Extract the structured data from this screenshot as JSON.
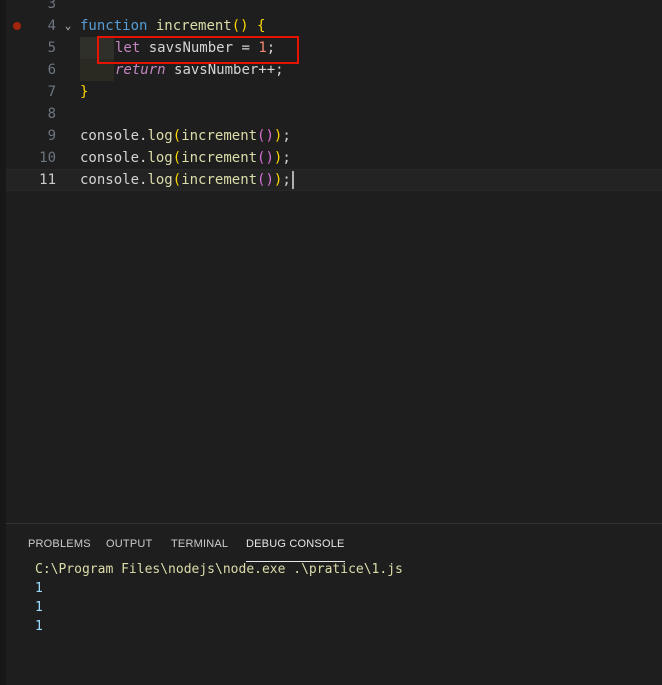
{
  "editor": {
    "line_numbers": [
      "3",
      "4",
      "5",
      "6",
      "7",
      "8",
      "9",
      "10",
      "11"
    ],
    "lines": {
      "l4": {
        "kw": "function",
        "name": "increment",
        "open_paren": "(",
        "close_paren": ")",
        "brace": " {"
      },
      "l5": {
        "kw": "let",
        "var": "savsNumber",
        "op": " = ",
        "num": "1",
        "semi": ";"
      },
      "l6": {
        "kw": "return",
        "var": "savsNumber",
        "op": "++;"
      },
      "l7": {
        "brace": "}"
      },
      "l9": {
        "obj": "console",
        "dot": ".",
        "method": "log",
        "p1": "(",
        "fn": "increment",
        "p2": "()",
        "p3": ")",
        "semi": ";"
      },
      "l10": {
        "obj": "console",
        "dot": ".",
        "method": "log",
        "p1": "(",
        "fn": "increment",
        "p2": "()",
        "p3": ")",
        "semi": ";"
      },
      "l11": {
        "obj": "console",
        "dot": ".",
        "method": "log",
        "p1": "(",
        "fn": "increment",
        "p2": "()",
        "p3": ")",
        "semi": ";"
      }
    },
    "breakpoint_line": "4",
    "active_line": "11"
  },
  "panel": {
    "tabs": [
      "PROBLEMS",
      "OUTPUT",
      "TERMINAL",
      "DEBUG CONSOLE"
    ],
    "active_tab": "DEBUG CONSOLE",
    "console": {
      "command": "C:\\Program Files\\nodejs\\node.exe .\\pratice\\1.js",
      "outputs": [
        "1",
        "1",
        "1"
      ]
    }
  },
  "colors": {
    "background": "#1e1e1e",
    "keyword": "#c586c0",
    "function": "#dcdcaa",
    "variable": "#9cdcfe",
    "highlight_box": "#e51400"
  }
}
